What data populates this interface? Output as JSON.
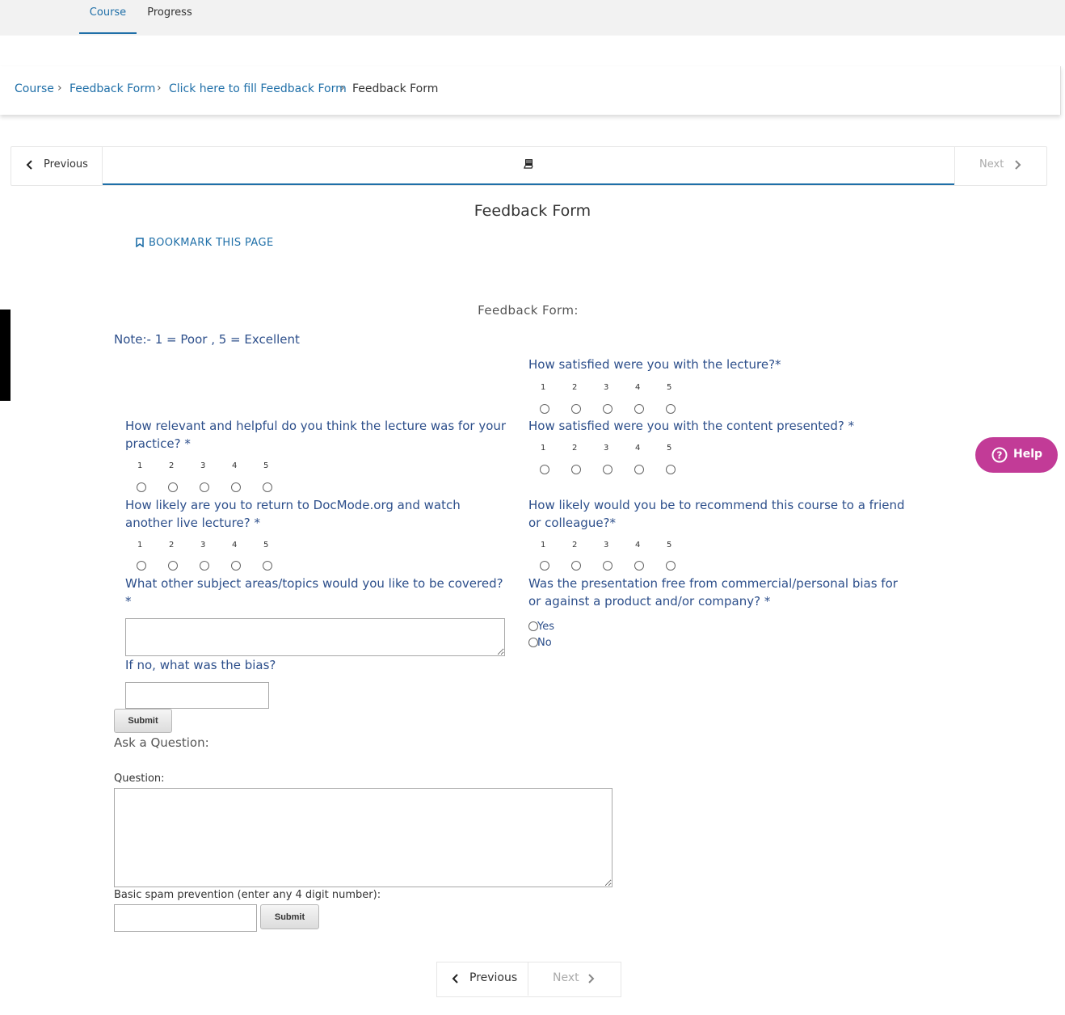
{
  "tabs": {
    "course": "Course",
    "progress": "Progress"
  },
  "breadcrumb": {
    "items": [
      "Course",
      "Feedback Form",
      "Click here to fill Feedback Form"
    ],
    "current": "Feedback Form",
    "separator": "›"
  },
  "sequence_nav": {
    "previous": "Previous",
    "next": "Next",
    "active_icon": "book-icon"
  },
  "page_title": "Feedback Form",
  "bookmark_label": "BOOKMARK THIS PAGE",
  "form": {
    "title": "Feedback Form:",
    "note": "Note:- 1 = Poor , 5 = Excellent",
    "scale": [
      "1",
      "2",
      "3",
      "4",
      "5"
    ],
    "questions": {
      "q1": "How satisfied were you with the lecture?*",
      "q2": "How relevant and helpful do you think the lecture was for your practice? *",
      "q3": "How satisfied were you with the content presented? *",
      "q4": "How likely are you to return to DocMode.org and watch another live lecture? *",
      "q5": "How likely would you be to recommend this course to a friend or colleague?*",
      "q6": "What other subject areas/topics would you like to be covered? *",
      "q7": "Was the presentation free from commercial/personal bias for or against a product and/or company? *",
      "q8": "If no, what was the bias?"
    },
    "yes_label": "Yes",
    "no_label": "No",
    "submit_label": "Submit"
  },
  "ask": {
    "title": "Ask a Question:",
    "question_label": "Question:",
    "spam_label": "Basic spam prevention (enter any 4 digit number):",
    "submit_label": "Submit"
  },
  "help_label": "Help",
  "bottom_nav": {
    "previous": "Previous",
    "next": "Next"
  },
  "colors": {
    "link": "#1f6fa8",
    "question": "#2d4f8b",
    "help": "#c23b97"
  }
}
